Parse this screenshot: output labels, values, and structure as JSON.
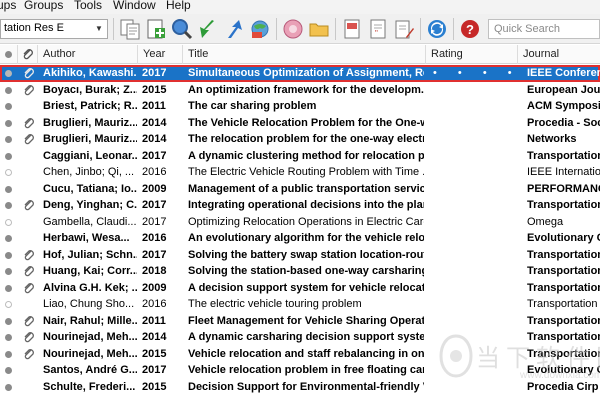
{
  "menu": [
    "ups",
    "Groups",
    "Tools",
    "Window",
    "Help"
  ],
  "toolbar": {
    "style_value": "tation Res E",
    "search_placeholder": "Quick Search"
  },
  "columns": [
    "Author",
    "Year",
    "Title",
    "Rating",
    "Journal"
  ],
  "selected_rating": "• • • • •",
  "rows": [
    {
      "author": "Akihiko, Kawashi...",
      "year": "2017",
      "title": "Simultaneous Optimization of Assignment, Re...",
      "journal": "IEEE Conferenc...",
      "attach": true,
      "read": false,
      "selected": true
    },
    {
      "author": "Boyacı, Burak; Z...",
      "year": "2015",
      "title": "An optimization framework for the developm...",
      "journal": "European Jour...",
      "attach": true,
      "read": false
    },
    {
      "author": "Briest, Patrick; R...",
      "year": "2011",
      "title": "The car sharing problem",
      "journal": "ACM Symposiu...",
      "attach": false,
      "read": false
    },
    {
      "author": "Bruglieri, Mauriz...",
      "year": "2014",
      "title": "The Vehicle Relocation Problem for the One-w...",
      "journal": "Procedia - Soci...",
      "attach": true,
      "read": false
    },
    {
      "author": "Bruglieri, Mauriz...",
      "year": "2014",
      "title": "The relocation problem for the one-way electr...",
      "journal": "Networks",
      "attach": true,
      "read": false
    },
    {
      "author": "Caggiani, Leonar...",
      "year": "2017",
      "title": "A dynamic clustering method for relocation pr...",
      "journal": "Transportation",
      "attach": false,
      "read": false
    },
    {
      "author": "Chen, Jinbo; Qi, ...",
      "year": "2016",
      "title": "The Electric Vehicle Routing Problem with Time ...",
      "journal": "IEEE Internation...",
      "attach": false,
      "read": true
    },
    {
      "author": "Cucu, Tatiana; Io...",
      "year": "2009",
      "title": "Management of a public transportation servic...",
      "journal": "PERFORMANCE",
      "attach": false,
      "read": false
    },
    {
      "author": "Deng, Yinghan; C...",
      "year": "2017",
      "title": "Integrating operational decisions into the plan...",
      "journal": "Transportation",
      "attach": true,
      "read": false
    },
    {
      "author": "Gambella, Claudi...",
      "year": "2017",
      "title": "Optimizing Relocation Operations in Electric Car-...",
      "journal": "Omega",
      "attach": false,
      "read": true
    },
    {
      "author": "Herbawi, Wesa...",
      "year": "2016",
      "title": "An evolutionary algorithm for the vehicle relo...",
      "journal": "Evolutionary C...",
      "attach": false,
      "read": false
    },
    {
      "author": "Hof, Julian; Schn...",
      "year": "2017",
      "title": "Solving the battery swap station location-routi...",
      "journal": "Transportation",
      "attach": true,
      "read": false
    },
    {
      "author": "Huang, Kai; Corr...",
      "year": "2018",
      "title": "Solving the station-based one-way carsharing ...",
      "journal": "Transportation",
      "attach": true,
      "read": false
    },
    {
      "author": "Alvina G.H. Kek; ...",
      "year": "2009",
      "title": "A decision support system for vehicle relocatio...",
      "journal": "Transportation",
      "attach": true,
      "read": false
    },
    {
      "author": "Liao, Chung Sho...",
      "year": "2016",
      "title": "The electric vehicle touring problem",
      "journal": "Transportation ...",
      "attach": false,
      "read": true
    },
    {
      "author": "Nair, Rahul; Mille...",
      "year": "2011",
      "title": "Fleet Management for Vehicle Sharing Operati...",
      "journal": "Transportation",
      "attach": true,
      "read": false
    },
    {
      "author": "Nourinejad, Meh...",
      "year": "2014",
      "title": "A dynamic carsharing decision support system",
      "journal": "Transportation",
      "attach": true,
      "read": false
    },
    {
      "author": "Nourinejad, Meh...",
      "year": "2015",
      "title": "Vehicle relocation and staff rebalancing in one...",
      "journal": "Transportation",
      "attach": true,
      "read": false
    },
    {
      "author": "Santos, André G...",
      "year": "2017",
      "title": "Vehicle relocation problem in free floating car...",
      "journal": "Evolutionary C...",
      "attach": false,
      "read": false
    },
    {
      "author": "Schulte, Frederi...",
      "year": "2015",
      "title": "Decision Support for Environmental-friendly V...",
      "journal": "Procedia Cirp",
      "attach": false,
      "read": false
    }
  ],
  "watermark": {
    "text": "当下软件园",
    "url": "www.downxia.com"
  },
  "colors": {
    "selection": "#1a73c7",
    "selection_border": "#e03030"
  }
}
